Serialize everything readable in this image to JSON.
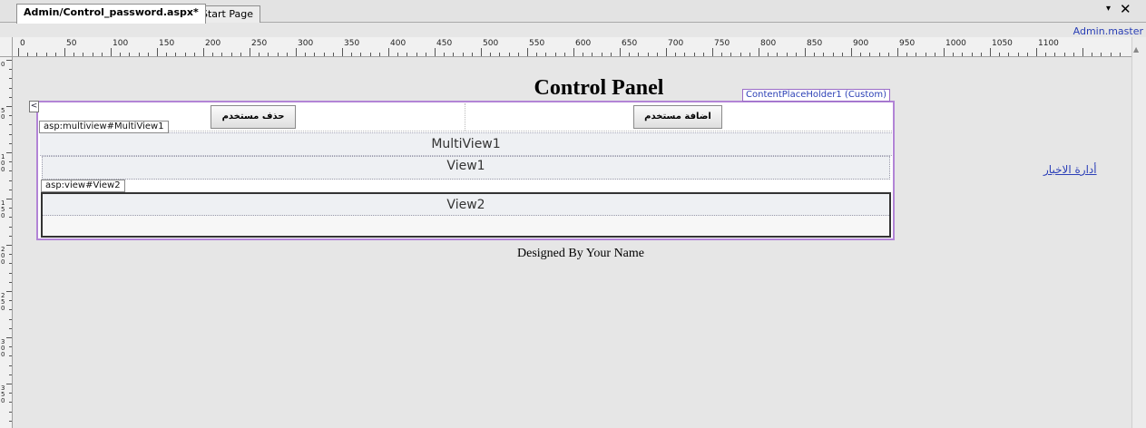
{
  "tabs": {
    "active": "Admin/Control_password.aspx*",
    "other": "Start Page"
  },
  "window_controls": {
    "dropdown_icon": "triangle-down-icon",
    "close_icon": "close-icon",
    "dropdown_glyph": "▾",
    "close_glyph": "✕"
  },
  "master_file": "Admin.master",
  "ruler": {
    "h_labels": [
      "0",
      "50",
      "100",
      "150",
      "200",
      "250",
      "300",
      "350",
      "400",
      "450",
      "500",
      "550",
      "600",
      "650",
      "700",
      "750",
      "800",
      "850",
      "900",
      "950",
      "1000",
      "1050",
      "1100"
    ],
    "v_labels": [
      "0",
      "50",
      "100",
      "150",
      "200",
      "250",
      "300",
      "350"
    ]
  },
  "design": {
    "title": "Control Panel",
    "content_placeholder_tag": "ContentPlaceHolder1 (Custom)",
    "collapse_glyph": "<",
    "delete_user_button": "حذف مستخدم",
    "add_user_button": "اضافة مستخدم",
    "multiview_tag": "asp:multiview#MultiView1",
    "multiview_label": "MultiView1",
    "view1_label": "View1",
    "view2_tag": "asp:view#View2",
    "view2_label": "View2",
    "footer": "Designed By Your Name",
    "news_link": "أدارة الاخبار"
  },
  "colors": {
    "placeholder_border": "#b284d6",
    "link": "#2b3fb8",
    "canvas": "#e6e6e6"
  }
}
